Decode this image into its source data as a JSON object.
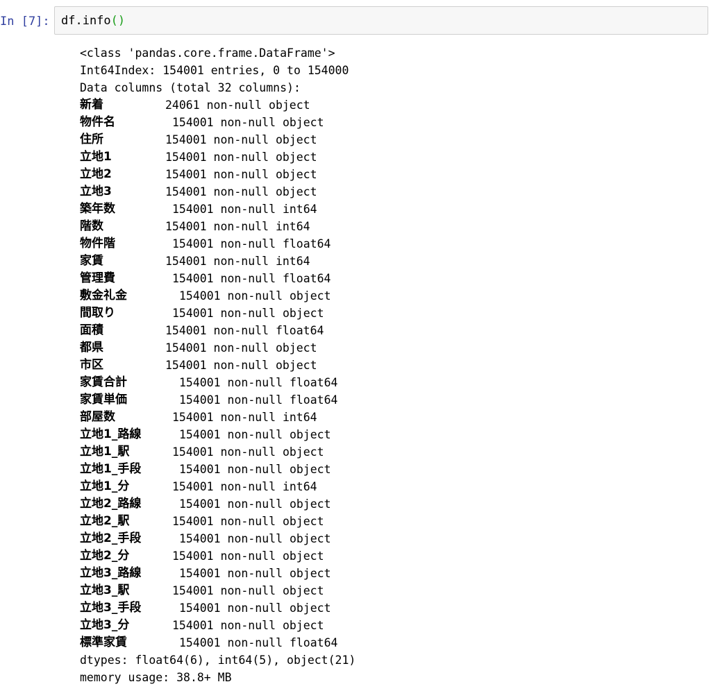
{
  "cell": {
    "prompt": "In [7]:",
    "code_prefix": "df.info",
    "code_parens": "()"
  },
  "output": {
    "header_lines": [
      "<class 'pandas.core.frame.DataFrame'>",
      "Int64Index: 154001 entries, 0 to 154000",
      "Data columns (total 32 columns):"
    ],
    "columns": [
      {
        "name": "新着",
        "info": "24061 non-null object"
      },
      {
        "name": "物件名",
        "info": "154001 non-null object"
      },
      {
        "name": "住所",
        "info": "154001 non-null object"
      },
      {
        "name": "立地1",
        "info": "154001 non-null object"
      },
      {
        "name": "立地2",
        "info": "154001 non-null object"
      },
      {
        "name": "立地3",
        "info": "154001 non-null object"
      },
      {
        "name": "築年数",
        "info": "154001 non-null int64"
      },
      {
        "name": "階数",
        "info": "154001 non-null int64"
      },
      {
        "name": "物件階",
        "info": "154001 non-null float64"
      },
      {
        "name": "家賃",
        "info": "154001 non-null int64"
      },
      {
        "name": "管理費",
        "info": "154001 non-null float64"
      },
      {
        "name": "敷金礼金",
        "info": "154001 non-null object"
      },
      {
        "name": "間取り",
        "info": "154001 non-null object"
      },
      {
        "name": "面積",
        "info": "154001 non-null float64"
      },
      {
        "name": "都県",
        "info": "154001 non-null object"
      },
      {
        "name": "市区",
        "info": "154001 non-null object"
      },
      {
        "name": "家賃合計",
        "info": "154001 non-null float64"
      },
      {
        "name": "家賃単価",
        "info": "154001 non-null float64"
      },
      {
        "name": "部屋数",
        "info": "154001 non-null int64"
      },
      {
        "name": "立地1_路線",
        "info": "154001 non-null object"
      },
      {
        "name": "立地1_駅",
        "info": "154001 non-null object"
      },
      {
        "name": "立地1_手段",
        "info": "154001 non-null object"
      },
      {
        "name": "立地1_分",
        "info": "154001 non-null int64"
      },
      {
        "name": "立地2_路線",
        "info": "154001 non-null object"
      },
      {
        "name": "立地2_駅",
        "info": "154001 non-null object"
      },
      {
        "name": "立地2_手段",
        "info": "154001 non-null object"
      },
      {
        "name": "立地2_分",
        "info": "154001 non-null object"
      },
      {
        "name": "立地3_路線",
        "info": "154001 non-null object"
      },
      {
        "name": "立地3_駅",
        "info": "154001 non-null object"
      },
      {
        "name": "立地3_手段",
        "info": "154001 non-null object"
      },
      {
        "name": "立地3_分",
        "info": "154001 non-null object"
      },
      {
        "name": "標準家賃",
        "info": "154001 non-null float64"
      }
    ],
    "footer_lines": [
      "dtypes: float64(6), int64(5), object(21)",
      "memory usage: 38.8+ MB"
    ]
  },
  "colors": {
    "prompt": "#303f9f",
    "input_bg": "#f7f7f7",
    "input_border": "#cfcfcf",
    "paren": "#1b9e1b"
  }
}
